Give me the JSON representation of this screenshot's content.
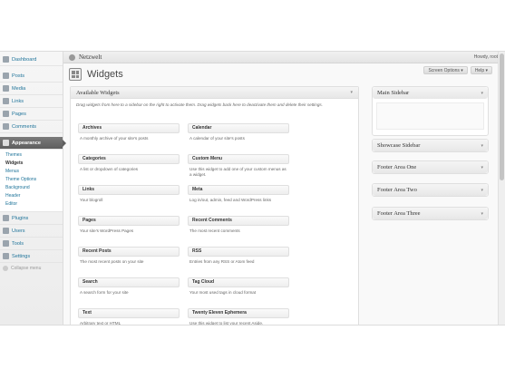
{
  "sidebar": {
    "items": [
      {
        "label": "Dashboard"
      },
      {
        "label": "Posts"
      },
      {
        "label": "Media"
      },
      {
        "label": "Links"
      },
      {
        "label": "Pages"
      },
      {
        "label": "Comments"
      },
      {
        "label": "Appearance"
      }
    ],
    "appearance_sub": [
      "Themes",
      "Widgets",
      "Menus",
      "Theme Options",
      "Background",
      "Header",
      "Editor"
    ],
    "items_after": [
      {
        "label": "Plugins"
      },
      {
        "label": "Users"
      },
      {
        "label": "Tools"
      },
      {
        "label": "Settings"
      }
    ],
    "collapse_label": "Collapse menu"
  },
  "adminbar": {
    "site_name": "Netzwelt",
    "howdy": "Howdy, root"
  },
  "header": {
    "title": "Widgets",
    "screen_options": "Screen Options ▾",
    "help": "Help ▾"
  },
  "available": {
    "title": "Available Widgets",
    "description": "Drag widgets from here to a sidebar on the right to activate them. Drag widgets back here to deactivate them and delete their settings.",
    "widgets": [
      {
        "name": "Archives",
        "desc": "A monthly archive of your site's posts"
      },
      {
        "name": "Calendar",
        "desc": "A calendar of your site's posts"
      },
      {
        "name": "Categories",
        "desc": "A list or dropdown of categories"
      },
      {
        "name": "Custom Menu",
        "desc": "Use this widget to add one of your custom menus as a widget."
      },
      {
        "name": "Links",
        "desc": "Your blogroll"
      },
      {
        "name": "Meta",
        "desc": "Log in/out, admin, feed and WordPress links"
      },
      {
        "name": "Pages",
        "desc": "Your site's WordPress Pages"
      },
      {
        "name": "Recent Comments",
        "desc": "The most recent comments"
      },
      {
        "name": "Recent Posts",
        "desc": "The most recent posts on your site"
      },
      {
        "name": "RSS",
        "desc": "Entries from any RSS or Atom feed"
      },
      {
        "name": "Search",
        "desc": "A search form for your site"
      },
      {
        "name": "Tag Cloud",
        "desc": "Your most used tags in cloud format"
      },
      {
        "name": "Text",
        "desc": "Arbitrary text or HTML"
      },
      {
        "name": "Twenty Eleven Ephemera",
        "desc": "Use this widget to list your recent Aside,"
      }
    ]
  },
  "sidebars": [
    {
      "title": "Main Sidebar"
    },
    {
      "title": "Showcase Sidebar"
    },
    {
      "title": "Footer Area One"
    },
    {
      "title": "Footer Area Two"
    },
    {
      "title": "Footer Area Three"
    }
  ]
}
